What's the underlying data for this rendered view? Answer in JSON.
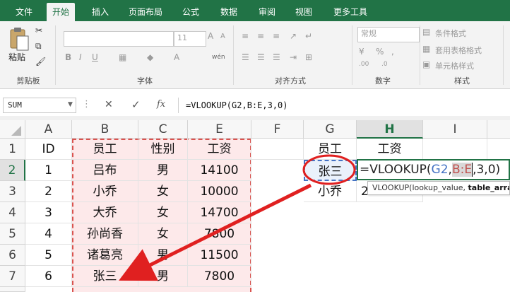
{
  "ribbon": {
    "tabs": [
      {
        "label": "文件",
        "active": false
      },
      {
        "label": "开始",
        "active": true
      },
      {
        "label": "插入",
        "active": false
      },
      {
        "label": "页面布局",
        "active": false
      },
      {
        "label": "公式",
        "active": false
      },
      {
        "label": "数据",
        "active": false
      },
      {
        "label": "审阅",
        "active": false
      },
      {
        "label": "视图",
        "active": false
      },
      {
        "label": "更多工具",
        "active": false
      }
    ],
    "groups": {
      "clipboard": {
        "label": "剪贴板",
        "paste_label": "粘贴"
      },
      "font": {
        "label": "字体",
        "font_size": "11"
      },
      "alignment": {
        "label": "对齐方式",
        "phonetic": "wén"
      },
      "number": {
        "label": "数字",
        "format": "常规"
      },
      "styles": {
        "label": "样式",
        "items": [
          "条件格式",
          "套用表格格式",
          "单元格样式"
        ]
      }
    }
  },
  "formula_bar": {
    "name_box": "SUM",
    "cancel_icon": "✕",
    "enter_icon": "✓",
    "fx_label": "fx",
    "formula": "=VLOOKUP(G2,B:E,3,0)"
  },
  "grid": {
    "columns": [
      "A",
      "B",
      "C",
      "E",
      "F",
      "G",
      "H",
      "I"
    ],
    "rows": [
      "1",
      "2",
      "3",
      "4",
      "5",
      "6",
      "7"
    ],
    "table_headers": {
      "id": "ID",
      "employee": "员工",
      "gender": "性别",
      "salary": "工资"
    },
    "table_rows": [
      {
        "id": "1",
        "name": "吕布",
        "gender": "男",
        "salary": "14100"
      },
      {
        "id": "2",
        "name": "小乔",
        "gender": "女",
        "salary": "10000"
      },
      {
        "id": "3",
        "name": "大乔",
        "gender": "女",
        "salary": "14700"
      },
      {
        "id": "4",
        "name": "孙尚香",
        "gender": "女",
        "salary": "7800"
      },
      {
        "id": "5",
        "name": "诸葛亮",
        "gender": "男",
        "salary": "11500"
      },
      {
        "id": "6",
        "name": "张三",
        "gender": "男",
        "salary": "7800"
      }
    ],
    "lookup": {
      "header_employee": "员工",
      "header_salary": "工资",
      "g2": "张三",
      "g3": "小乔",
      "h3_partial": "2"
    },
    "edit": {
      "prefix": "=VLOOKUP(",
      "arg1": "G2",
      "sep1": ",",
      "arg2": "B:E",
      "rest": ",3,0)"
    },
    "tooltip": {
      "fn": "VLOOKUP(lookup_value, ",
      "bold": "table_array"
    }
  },
  "colors": {
    "excel_green": "#217346",
    "ref_blue": "#4472c4",
    "ref_red": "#c0504d",
    "annotation_red": "#e02020",
    "table_fill": "#fde9ea"
  }
}
